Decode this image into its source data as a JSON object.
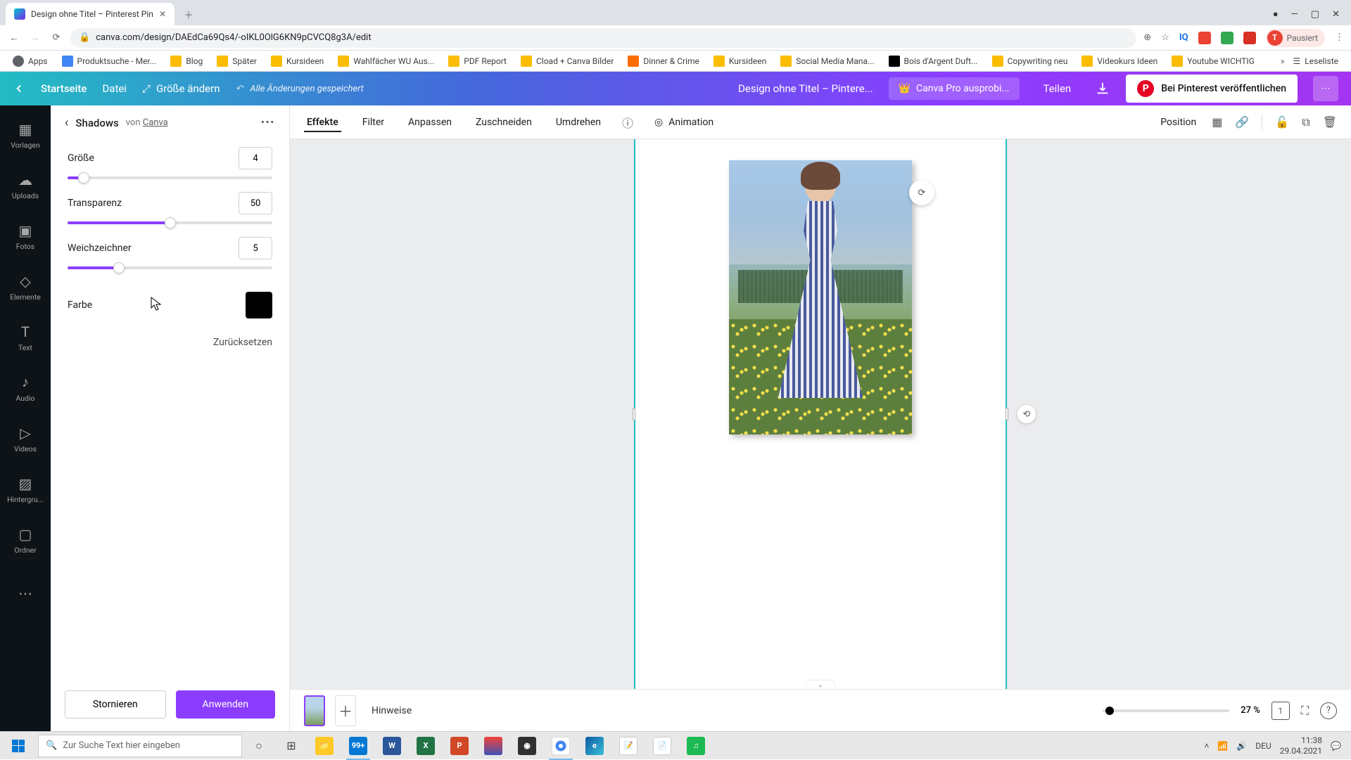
{
  "browser": {
    "tab_title": "Design ohne Titel – Pinterest Pin",
    "url": "canva.com/design/DAEdCa69Qs4/-oIKL0OlG6KN9pCVCQ8g3A/edit",
    "profile_status": "Pausiert",
    "profile_initial": "T"
  },
  "bookmarks": [
    {
      "label": "Apps"
    },
    {
      "label": "Produktsuche - Mer..."
    },
    {
      "label": "Blog"
    },
    {
      "label": "Später"
    },
    {
      "label": "Kursideen"
    },
    {
      "label": "Wahlfächer WU Aus..."
    },
    {
      "label": "PDF Report"
    },
    {
      "label": "Cload + Canva Bilder"
    },
    {
      "label": "Dinner & Crime"
    },
    {
      "label": "Kursideen"
    },
    {
      "label": "Social Media Mana..."
    },
    {
      "label": "Bois d'Argent Duft..."
    },
    {
      "label": "Copywriting neu"
    },
    {
      "label": "Videokurs Ideen"
    },
    {
      "label": "Youtube WICHTIG"
    }
  ],
  "bookmarks_right": "Leseliste",
  "header": {
    "home": "Startseite",
    "file": "Datei",
    "resize": "Größe ändern",
    "saved": "Alle Änderungen gespeichert",
    "doc_title": "Design ohne Titel – Pintere...",
    "pro": "Canva Pro ausprobi...",
    "share": "Teilen",
    "pinterest": "Bei Pinterest veröffentlichen"
  },
  "rail": [
    {
      "icon": "▦",
      "label": "Vorlagen"
    },
    {
      "icon": "☁",
      "label": "Uploads"
    },
    {
      "icon": "▣",
      "label": "Fotos"
    },
    {
      "icon": "◇",
      "label": "Elemente"
    },
    {
      "icon": "T",
      "label": "Text"
    },
    {
      "icon": "♪",
      "label": "Audio"
    },
    {
      "icon": "▷",
      "label": "Videos"
    },
    {
      "icon": "▨",
      "label": "Hintergru..."
    },
    {
      "icon": "▢",
      "label": "Ordner"
    }
  ],
  "panel": {
    "title": "Shadows",
    "by_prefix": "von ",
    "by_link": "Canva",
    "controls": {
      "size": {
        "label": "Größe",
        "value": "4",
        "pct": 8
      },
      "transparency": {
        "label": "Transparenz",
        "value": "50",
        "pct": 50
      },
      "blur": {
        "label": "Weichzeichner",
        "value": "5",
        "pct": 25
      },
      "color": {
        "label": "Farbe",
        "hex": "#000000"
      }
    },
    "reset": "Zurücksetzen",
    "cancel": "Stornieren",
    "apply": "Anwenden"
  },
  "context": {
    "effects": "Effekte",
    "filter": "Filter",
    "adjust": "Anpassen",
    "crop": "Zuschneiden",
    "flip": "Umdrehen",
    "animation": "Animation",
    "position": "Position"
  },
  "strip": {
    "notes": "Hinweise",
    "zoom": "27 %",
    "page_num": "1"
  },
  "taskbar": {
    "search_placeholder": "Zur Suche Text hier eingeben",
    "lang": "DEU",
    "time": "11:38",
    "date": "29.04.2021"
  }
}
